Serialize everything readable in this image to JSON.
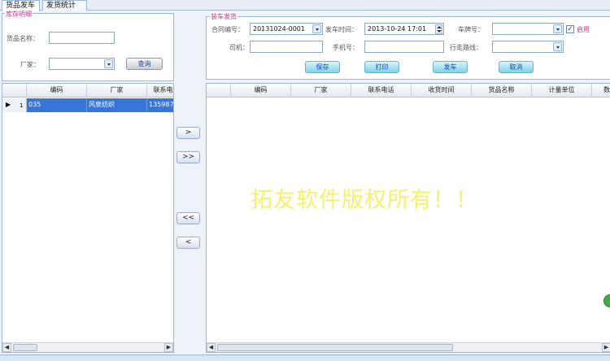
{
  "tabs": [
    {
      "label": "货品发车"
    },
    {
      "label": "发货统计"
    }
  ],
  "left": {
    "group_title": "库存明细",
    "goods_label": "货品名称：",
    "goods_value": "",
    "maker_label": "厂家：",
    "maker_value": "",
    "query_label": "查询",
    "columns": [
      "编码",
      "厂家",
      "联系电"
    ],
    "rows": [
      {
        "index": "1",
        "code": "035",
        "maker": "风泉纺织",
        "phone": "1359874"
      }
    ]
  },
  "move_buttons": [
    ">",
    ">>",
    "<<",
    "<"
  ],
  "right": {
    "group_title": "装车发货",
    "contract_label": "合同编号：",
    "contract_value": "20131024-0001",
    "time_label": "发车时间：",
    "time_value": "2013-10-24 17:01",
    "plate_label": "车牌号：",
    "plate_value": "",
    "enable_label": "启用",
    "enable_checked": true,
    "driver_label": "司机：",
    "driver_value": "",
    "mobile_label": "手机号：",
    "mobile_value": "",
    "route_label": "行走路线：",
    "route_value": "",
    "buttons": {
      "save": "保存",
      "print": "打印",
      "depart": "发车",
      "cancel": "取消"
    },
    "columns": [
      "编码",
      "厂家",
      "联系电话",
      "收货时间",
      "货品名称",
      "计量单位",
      "数"
    ],
    "rows": []
  },
  "watermark": "拓友软件版权所有！！",
  "colors": {
    "group_title": "#c0368a",
    "selection": "#3875d7",
    "button_text": "#1a3dd1",
    "watermark": "#f5f26a"
  }
}
